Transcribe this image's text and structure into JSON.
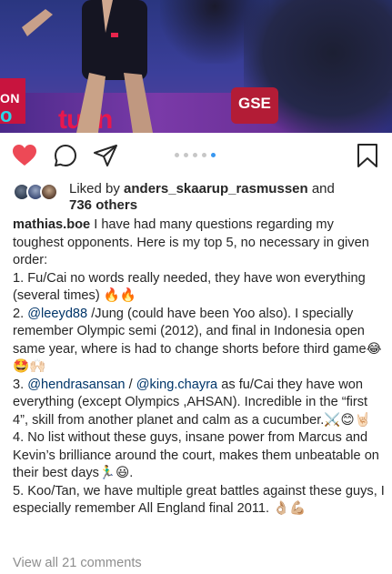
{
  "post": {
    "photo_ads": {
      "ad_left_top": "ON",
      "ad_left_big": "o",
      "ad_center": "tuen",
      "ad_right": "GSE"
    },
    "carousel": {
      "count": 5,
      "active_index": 4
    },
    "likes": {
      "prefix": "Liked by ",
      "user": "anders_skaarup_rasmussen",
      "conj": " and",
      "others": "736 others"
    },
    "caption": {
      "username": "mathias.boe",
      "intro": " I have had many questions regarding my toughest opponents. Here is my top 5, no necessary in given order:",
      "item1": "1. Fu/Cai no words really needed, they have won everything (several times) 🔥🔥",
      "item2_prefix": "2. ",
      "item2_mention": "@leeyd88",
      "item2_text": " /Jung (could have been Yoo also). I specially remember Olympic semi (2012), and final in Indonesia open same year, where is had to change shorts before third game😂🤩🙌🏻",
      "item3_prefix": "3. ",
      "item3_mention1": "@hendrasansan",
      "item3_sep": " / ",
      "item3_mention2": "@king.chayra",
      "item3_text": " as fu/Cai they have won everything (except Olympics ,AHSAN). Incredible in the “first 4”, skill from another planet and calm as a cucumber.⚔️😊🤘🏻",
      "item4": "4. No list without these guys, insane power from Marcus and Kevin’s brilliance around the court, makes them unbeatable on their best days🏃‍♂️😃.",
      "item5": "5. Koo/Tan, we have multiple great battles against these guys, I especially remember All England final 2011. 👌🏼💪🏼"
    },
    "view_all_comments": "View all 21 comments"
  },
  "colors": {
    "heart": "#ed4956",
    "mention": "#003569",
    "muted": "#8e8e8e",
    "dot_active": "#3897f0",
    "dot_inactive": "#c7c7c7"
  },
  "icons": [
    "heart-icon",
    "comment-icon",
    "share-icon",
    "bookmark-icon"
  ]
}
